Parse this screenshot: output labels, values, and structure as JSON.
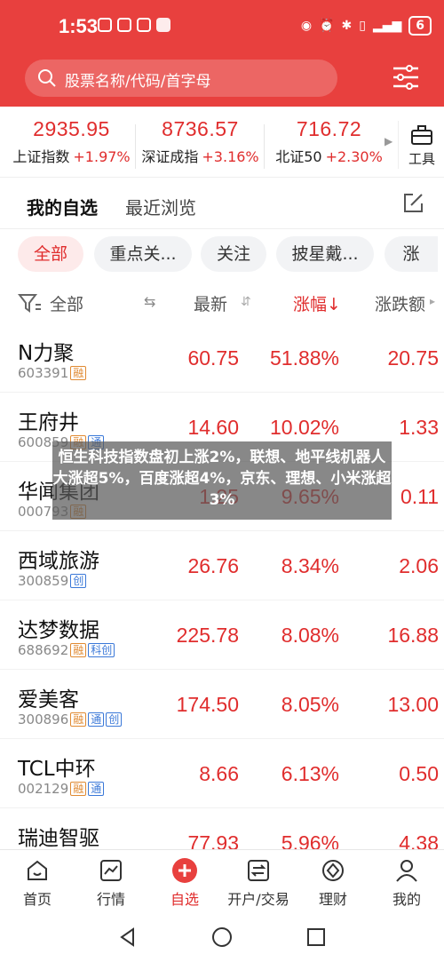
{
  "status": {
    "time": "1:53",
    "battery": "6"
  },
  "search": {
    "placeholder": "股票名称/代码/首字母"
  },
  "indices": [
    {
      "value": "2935.95",
      "name": "上证指数",
      "change": "+1.97%"
    },
    {
      "value": "8736.57",
      "name": "深证成指",
      "change": "+3.16%"
    },
    {
      "value": "716.72",
      "name": "北证50",
      "change": "+2.30%"
    }
  ],
  "tools_label": "工具",
  "tabs": {
    "active": "我的自选",
    "recent": "最近浏览"
  },
  "chips": [
    "全部",
    "重点关...",
    "关注",
    "披星戴...",
    "涨"
  ],
  "columns": {
    "filter": "全部",
    "latest": "最新",
    "pct": "涨幅↓",
    "change": "涨跌额"
  },
  "stocks": [
    {
      "name": "N力聚",
      "code": "603391",
      "tags": [
        "融"
      ],
      "price": "60.75",
      "pct": "51.88%",
      "chg": "20.75"
    },
    {
      "name": "王府井",
      "code": "600859",
      "tags": [
        "融",
        "通"
      ],
      "price": "14.60",
      "pct": "10.02%",
      "chg": "1.33"
    },
    {
      "name": "华闻集团",
      "code": "000793",
      "tags": [
        "融"
      ],
      "price": "1.25",
      "pct": "9.65%",
      "chg": "0.11"
    },
    {
      "name": "西域旅游",
      "code": "300859",
      "tags": [
        "创"
      ],
      "price": "26.76",
      "pct": "8.34%",
      "chg": "2.06"
    },
    {
      "name": "达梦数据",
      "code": "688692",
      "tags": [
        "融",
        "科创"
      ],
      "price": "225.78",
      "pct": "8.08%",
      "chg": "16.88"
    },
    {
      "name": "爱美客",
      "code": "300896",
      "tags": [
        "融",
        "通",
        "创"
      ],
      "price": "174.50",
      "pct": "8.05%",
      "chg": "13.00"
    },
    {
      "name": "TCL中环",
      "code": "002129",
      "tags": [
        "融",
        "通"
      ],
      "price": "8.66",
      "pct": "6.13%",
      "chg": "0.50"
    },
    {
      "name": "瑞迪智驱",
      "code": "",
      "tags": [],
      "price": "77.93",
      "pct": "5.96%",
      "chg": "4.38"
    }
  ],
  "banner": {
    "text": "恒生科技指数盘初上涨2%，联想、地平线机器人大涨超5%，百度涨超4%，京东、理想、小米涨超3%"
  },
  "nav": [
    "首页",
    "行情",
    "自选",
    "开户/交易",
    "理财",
    "我的"
  ],
  "colors": {
    "header_red": "#e8403e",
    "up_red": "#e02d2d",
    "tag_orange": "#e08a32",
    "tag_blue": "#3a78d8"
  }
}
